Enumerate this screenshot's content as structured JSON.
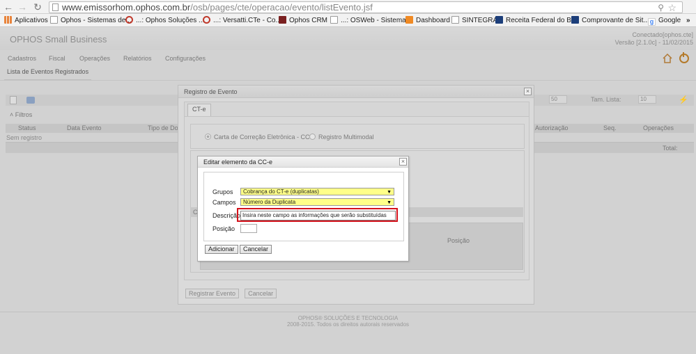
{
  "browser": {
    "url_host": "www.emissorhom.ophos.com.br",
    "url_path": "/osb/pages/cte/operacao/evento/listEvento.jsf",
    "bookmarks": [
      {
        "label": "Aplicativos",
        "icon": "apps-grid-icon",
        "color": "#e8843c"
      },
      {
        "label": "Ophos - Sistemas de...",
        "icon": "page-icon",
        "color": "#ffffff"
      },
      {
        "label": "...: Ophos Soluções ...",
        "icon": "opera-icon",
        "color": "#c0392b"
      },
      {
        "label": "...: Versatti.CTe - Co...",
        "icon": "opera-icon",
        "color": "#c0392b"
      },
      {
        "label": "Ophos CRM",
        "icon": "cube-icon",
        "color": "#7a2020"
      },
      {
        "label": "...: OSWeb - Sistema...",
        "icon": "page-icon",
        "color": "#ffffff"
      },
      {
        "label": "Dashboard",
        "icon": "dashboard-icon",
        "color": "#f08a24"
      },
      {
        "label": "SINTEGRA",
        "icon": "page-icon",
        "color": "#ffffff"
      },
      {
        "label": "Receita Federal do B...",
        "icon": "flag-icon",
        "color": "#1c3e7a"
      },
      {
        "label": "Comprovante de Sit...",
        "icon": "flag-icon",
        "color": "#1c3e7a"
      },
      {
        "label": "Google",
        "icon": "google-icon",
        "color": "#4285f4"
      },
      {
        "label": "»",
        "icon": "",
        "color": ""
      }
    ]
  },
  "app": {
    "title": "OPHOS Small Business",
    "connected": "Conectado[ophos.cte]",
    "version": "Versão [2.1.0c] - 11/02/2015",
    "menu": [
      "Cadastros",
      "Fiscal",
      "Operações",
      "Relatórios",
      "Configurações"
    ],
    "tab": "Lista de Eventos Registrados",
    "filters_label": "Filtros",
    "grid_columns": [
      "Status",
      "Data Evento",
      "Tipo de Do",
      "Autorização",
      "Seq.",
      "Operações"
    ],
    "no_record": "Sem registro",
    "total_label": "Total:",
    "page_size_value": "50",
    "list_size_label": "Tam. Lista:",
    "list_size_value": "10",
    "footer_company": "OPHOS® SOLUÇÕES E TECNOLOGIA",
    "footer_rights": "2008-2015. Todos os direitos autorais reservados"
  },
  "register_dialog": {
    "title": "Registro de Evento",
    "tab": "CT-e",
    "radio_option_1": "Carta de Correção Eletrônica - CC-e",
    "radio_option_2": "Registro Multimodal",
    "band_label": "Ca",
    "grid_col_posicao": "Posição",
    "register_button": "Registrar Evento",
    "cancel_button": "Cancelar"
  },
  "edit_dialog": {
    "title": "Editar elemento da CC-e",
    "grupos_label": "Grupos",
    "grupos_value": "Cobrança do CT-e (duplicatas)",
    "campos_label": "Campos",
    "campos_value": "Número da Duplicata",
    "descricao_label": "Descrição",
    "descricao_value": "Insira neste campo as informações que serão substituídas",
    "posicao_label": "Posição",
    "posicao_value": "",
    "add_button": "Adicionar",
    "cancel_button": "Cancelar",
    "highlight_color": "#d4111a",
    "select_color": "#ffff88"
  }
}
